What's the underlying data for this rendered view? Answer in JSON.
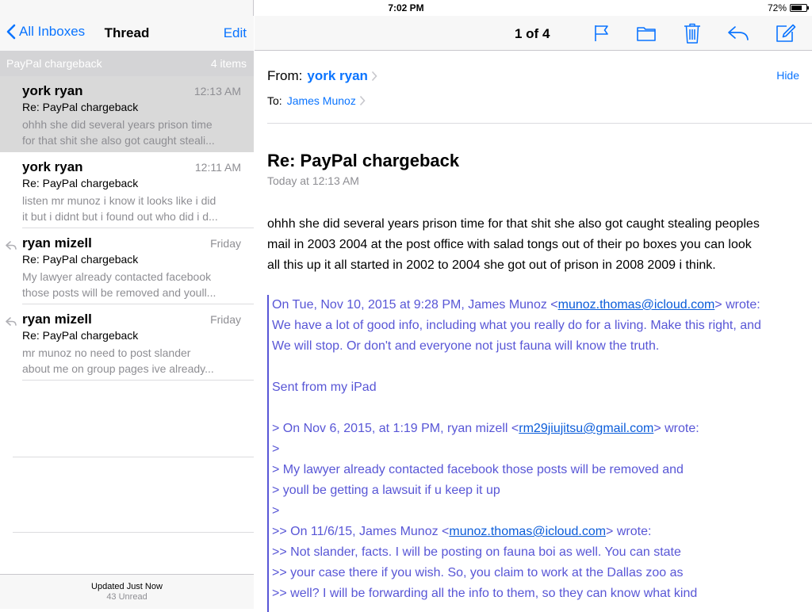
{
  "status": {
    "device": "iPad",
    "time": "7:02 PM",
    "battery_text": "72%",
    "battery_level": 0.72
  },
  "left_nav": {
    "back_label": "All Inboxes",
    "title": "Thread",
    "edit_label": "Edit"
  },
  "thread": {
    "subject": "PayPal chargeback",
    "count": "4 items"
  },
  "messages": [
    {
      "sender": "york ryan",
      "date": "12:13 AM",
      "subject": "Re: PayPal chargeback",
      "preview1": "ohhh she did several years prison time",
      "preview2": "for that shit she also got caught steali...",
      "replied": false,
      "selected": true
    },
    {
      "sender": "york ryan",
      "date": "12:11 AM",
      "subject": "Re: PayPal chargeback",
      "preview1": "listen mr munoz i know it looks like i did",
      "preview2": "it but i didnt but i found out who did i d...",
      "replied": false,
      "selected": false
    },
    {
      "sender": "ryan mizell",
      "date": "Friday",
      "subject": "Re: PayPal chargeback",
      "preview1": "My lawyer already contacted facebook",
      "preview2": "those posts will be removed and youll...",
      "replied": true,
      "selected": false
    },
    {
      "sender": "ryan mizell",
      "date": "Friday",
      "subject": "Re: PayPal chargeback",
      "preview1": "mr munoz no need to post slander",
      "preview2": "about me on group pages ive already...",
      "replied": true,
      "selected": false
    }
  ],
  "footer": {
    "updated": "Updated Just Now",
    "unread": "43 Unread"
  },
  "toolbar": {
    "pager": "1 of 4",
    "icons": [
      "flag-icon",
      "folder-icon",
      "trash-icon",
      "reply-icon",
      "compose-icon"
    ]
  },
  "email": {
    "from_label": "From:",
    "from_name": "york ryan",
    "to_label": "To:",
    "to_name": "James Munoz",
    "hide_label": "Hide",
    "subject": "Re: PayPal chargeback",
    "sent": "Today at 12:13 AM",
    "body_lines": [
      "ohhh she did several years prison time for that shit she also got caught stealing peoples",
      "mail in 2003 2004 at the post office with salad tongs out of their po boxes you can look",
      "all this up it all started in 2002 to 2004 she got out of prison in 2008 2009 i think."
    ],
    "quote": {
      "l1_pre": "On Tue, Nov 10, 2015 at 9:28 PM, James Munoz <",
      "l1_link": "munoz.thomas@icloud.com",
      "l1_post": "> wrote:",
      "l2": "We have a lot of good info, including what you really do for a living. Make this right, and",
      "l3": "We will stop. Or don't and everyone not just fauna will know the truth.",
      "l4": "",
      "l5": "Sent from my iPad",
      "l6": "",
      "l7_pre": "> On Nov 6, 2015, at 1:19 PM, ryan mizell <",
      "l7_link": "rm29jiujitsu@gmail.com",
      "l7_post": "> wrote:",
      "l8": ">",
      "l9": "> My lawyer already contacted facebook those posts will be removed and",
      "l10": "> youll be getting a lawsuit if u keep it up",
      "l11": ">",
      "l12_pre": ">> On 11/6/15, James Munoz <",
      "l12_link": "munoz.thomas@icloud.com",
      "l12_post": "> wrote:",
      "l13": ">> Not slander, facts. I will be posting on fauna boi as well. You can state",
      "l14": ">> your case there if you wish. So, you claim to work at the Dallas zoo as",
      "l15": ">> well? I will be forwarding all the info to them, so they can know what kind"
    }
  }
}
